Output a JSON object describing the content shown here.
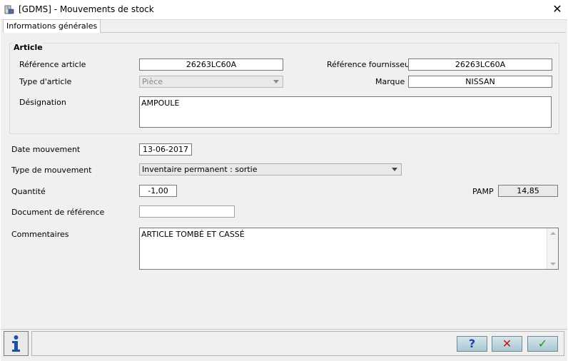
{
  "window": {
    "title": "[GDMS] - Mouvements de stock",
    "close_glyph": "✕"
  },
  "tabs": [
    {
      "label": "Informations générales"
    }
  ],
  "article": {
    "group_title": "Article",
    "ref_label": "Référence article",
    "ref_value": "26263LC60A",
    "supplier_ref_label": "Référence fournisseur",
    "supplier_ref_value": "26263LC60A",
    "type_label": "Type d'article",
    "type_value": "Pièce",
    "brand_label": "Marque",
    "brand_value": "NISSAN",
    "designation_label": "Désignation",
    "designation_value": "AMPOULE"
  },
  "movement": {
    "date_label": "Date mouvement",
    "date_value": "13-06-2017",
    "type_label": "Type de mouvement",
    "type_value": "Inventaire permanent : sortie",
    "qty_label": "Quantité",
    "qty_value": "-1,00",
    "pamp_label": "PAMP",
    "pamp_value": "14,85",
    "docref_label": "Document de référence",
    "docref_value": "",
    "comments_label": "Commentaires",
    "comments_value": "ARTICLE TOMBÉ ET CASSÉ"
  },
  "footer": {
    "info_icon": "info-icon",
    "help_glyph": "?",
    "cancel_glyph": "✕",
    "ok_glyph": "✓"
  },
  "colors": {
    "help": "#1f3fb0",
    "cancel": "#c01818",
    "ok": "#1a9a1a",
    "button_face": "#b7d0da"
  }
}
